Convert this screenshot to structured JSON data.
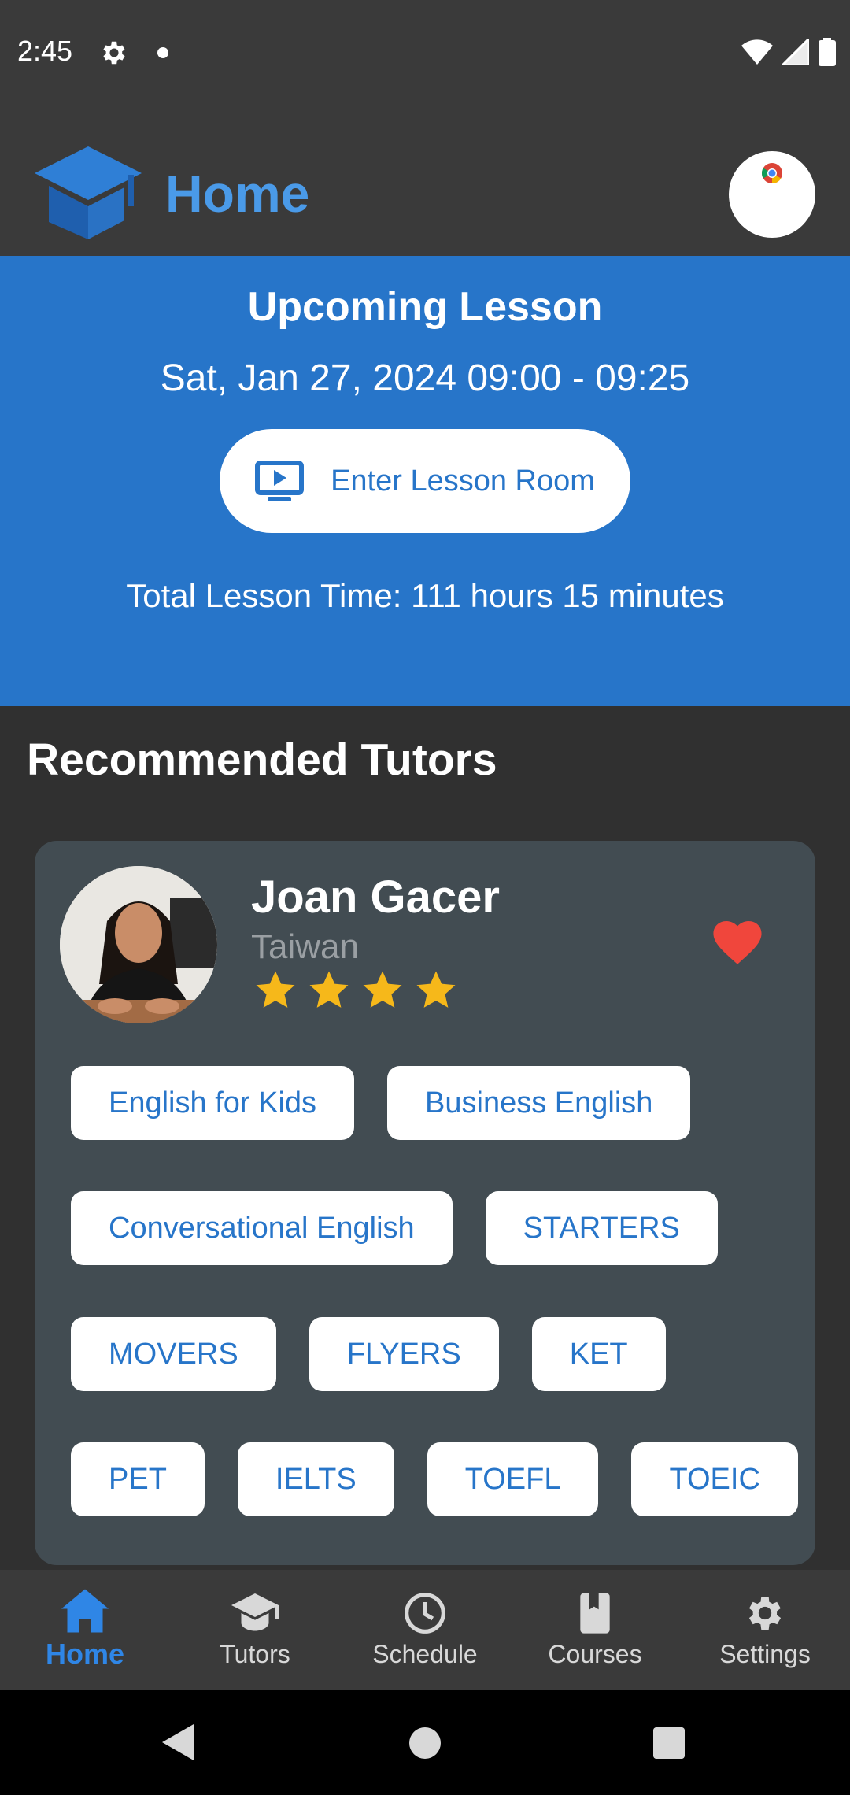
{
  "status_bar": {
    "time": "2:45"
  },
  "app_bar": {
    "title": "Home"
  },
  "upcoming": {
    "title": "Upcoming Lesson",
    "datetime": "Sat, Jan 27, 2024 09:00 - 09:25",
    "enter_label": "Enter Lesson Room",
    "total_time": "Total Lesson Time: 111 hours 15 minutes"
  },
  "recommended": {
    "title": "Recommended Tutors",
    "tutor": {
      "name": "Joan Gacer",
      "country": "Taiwan",
      "rating_stars": 4,
      "favorited": true,
      "tags": [
        [
          "English for Kids",
          "Business English"
        ],
        [
          "Conversational English",
          "STARTERS"
        ],
        [
          "MOVERS",
          "FLYERS",
          "KET"
        ],
        [
          "PET",
          "IELTS",
          "TOEFL",
          "TOEIC"
        ]
      ]
    }
  },
  "bottom_nav": {
    "items": [
      {
        "label": "Home",
        "icon": "home-icon",
        "active": true
      },
      {
        "label": "Tutors",
        "icon": "graduation-cap-icon",
        "active": false
      },
      {
        "label": "Schedule",
        "icon": "clock-icon",
        "active": false
      },
      {
        "label": "Courses",
        "icon": "book-icon",
        "active": false
      },
      {
        "label": "Settings",
        "icon": "gear-icon",
        "active": false
      }
    ]
  },
  "colors": {
    "accent": "#2775c9",
    "title_blue": "#4a9ae8",
    "card_bg": "#424c52",
    "star": "#f6b81a",
    "heart": "#f0463c"
  }
}
